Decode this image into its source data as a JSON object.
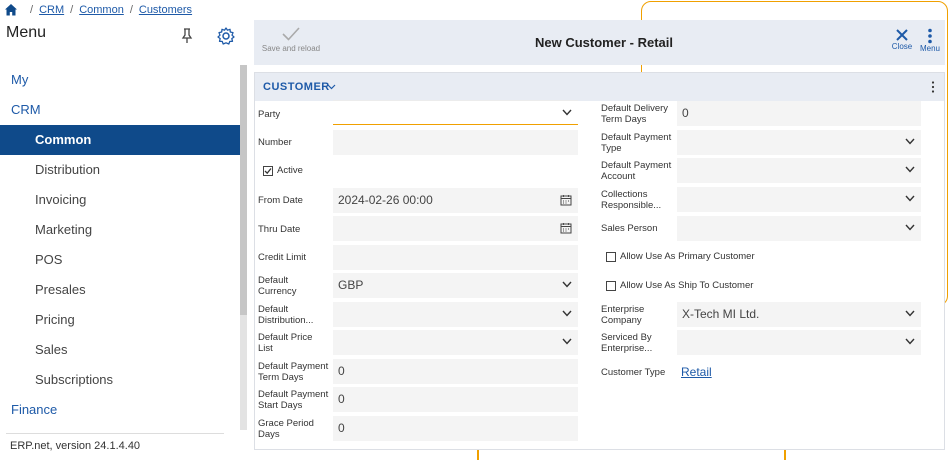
{
  "breadcrumb": {
    "items": [
      "CRM",
      "Common",
      "Customers"
    ]
  },
  "sidebar": {
    "title": "Menu",
    "items": [
      {
        "label": "My",
        "level": "top"
      },
      {
        "label": "CRM",
        "level": "top"
      },
      {
        "label": "Common",
        "level": "sub",
        "active": true
      },
      {
        "label": "Distribution",
        "level": "sub"
      },
      {
        "label": "Invoicing",
        "level": "sub"
      },
      {
        "label": "Marketing",
        "level": "sub"
      },
      {
        "label": "POS",
        "level": "sub"
      },
      {
        "label": "Presales",
        "level": "sub"
      },
      {
        "label": "Pricing",
        "level": "sub"
      },
      {
        "label": "Sales",
        "level": "sub"
      },
      {
        "label": "Subscriptions",
        "level": "sub"
      },
      {
        "label": "Finance",
        "level": "top"
      }
    ],
    "version": "ERP.net, version 24.1.4.40"
  },
  "toolbar": {
    "save_reload_label": "Save and reload",
    "title": "New Customer - Retail",
    "close_label": "Close",
    "menu_label": "Menu"
  },
  "card": {
    "title": "CUSTOMER"
  },
  "left": {
    "party": {
      "label": "Party",
      "value": ""
    },
    "number": {
      "label": "Number",
      "value": ""
    },
    "active": {
      "label": "Active",
      "checked": true
    },
    "from_date": {
      "label": "From Date",
      "value": "2024-02-26 00:00"
    },
    "thru_date": {
      "label": "Thru Date",
      "value": ""
    },
    "credit_limit": {
      "label": "Credit Limit",
      "value": ""
    },
    "default_currency": {
      "label": [
        "Default",
        "Currency"
      ],
      "value": "GBP"
    },
    "default_distribution": {
      "label": [
        "Default",
        "Distribution..."
      ],
      "value": ""
    },
    "default_price_list": {
      "label": [
        "Default Price",
        "List"
      ],
      "value": ""
    },
    "payment_term_days": {
      "label": [
        "Default Payment",
        "Term Days"
      ],
      "value": "0"
    },
    "payment_start_days": {
      "label": [
        "Default Payment",
        "Start Days"
      ],
      "value": "0"
    },
    "grace_period_days": {
      "label": [
        "Grace Period",
        "Days"
      ],
      "value": "0"
    }
  },
  "right": {
    "delivery_term_days": {
      "label": [
        "Default Delivery",
        "Term Days"
      ],
      "value": "0"
    },
    "payment_type": {
      "label": [
        "Default Payment",
        "Type"
      ],
      "value": ""
    },
    "payment_account": {
      "label": [
        "Default Payment",
        "Account"
      ],
      "value": ""
    },
    "collections": {
      "label": [
        "Collections",
        "Responsible..."
      ],
      "value": ""
    },
    "sales_person": {
      "label": "Sales Person",
      "value": ""
    },
    "allow_primary": {
      "label": "Allow Use As Primary Customer",
      "checked": false
    },
    "allow_ship_to": {
      "label": "Allow Use As Ship To Customer",
      "checked": false
    },
    "enterprise_company": {
      "label": [
        "Enterprise",
        "Company"
      ],
      "value": "X-Tech MI Ltd."
    },
    "serviced_by": {
      "label": [
        "Serviced By",
        "Enterprise..."
      ],
      "value": ""
    },
    "customer_type": {
      "label": "Customer Type",
      "value": "Retail"
    }
  },
  "colors": {
    "accent": "#1e5aa8",
    "active_nav": "#0f4a8a",
    "focus": "#f0a000",
    "toolbar_bg": "#e8ecf3"
  }
}
